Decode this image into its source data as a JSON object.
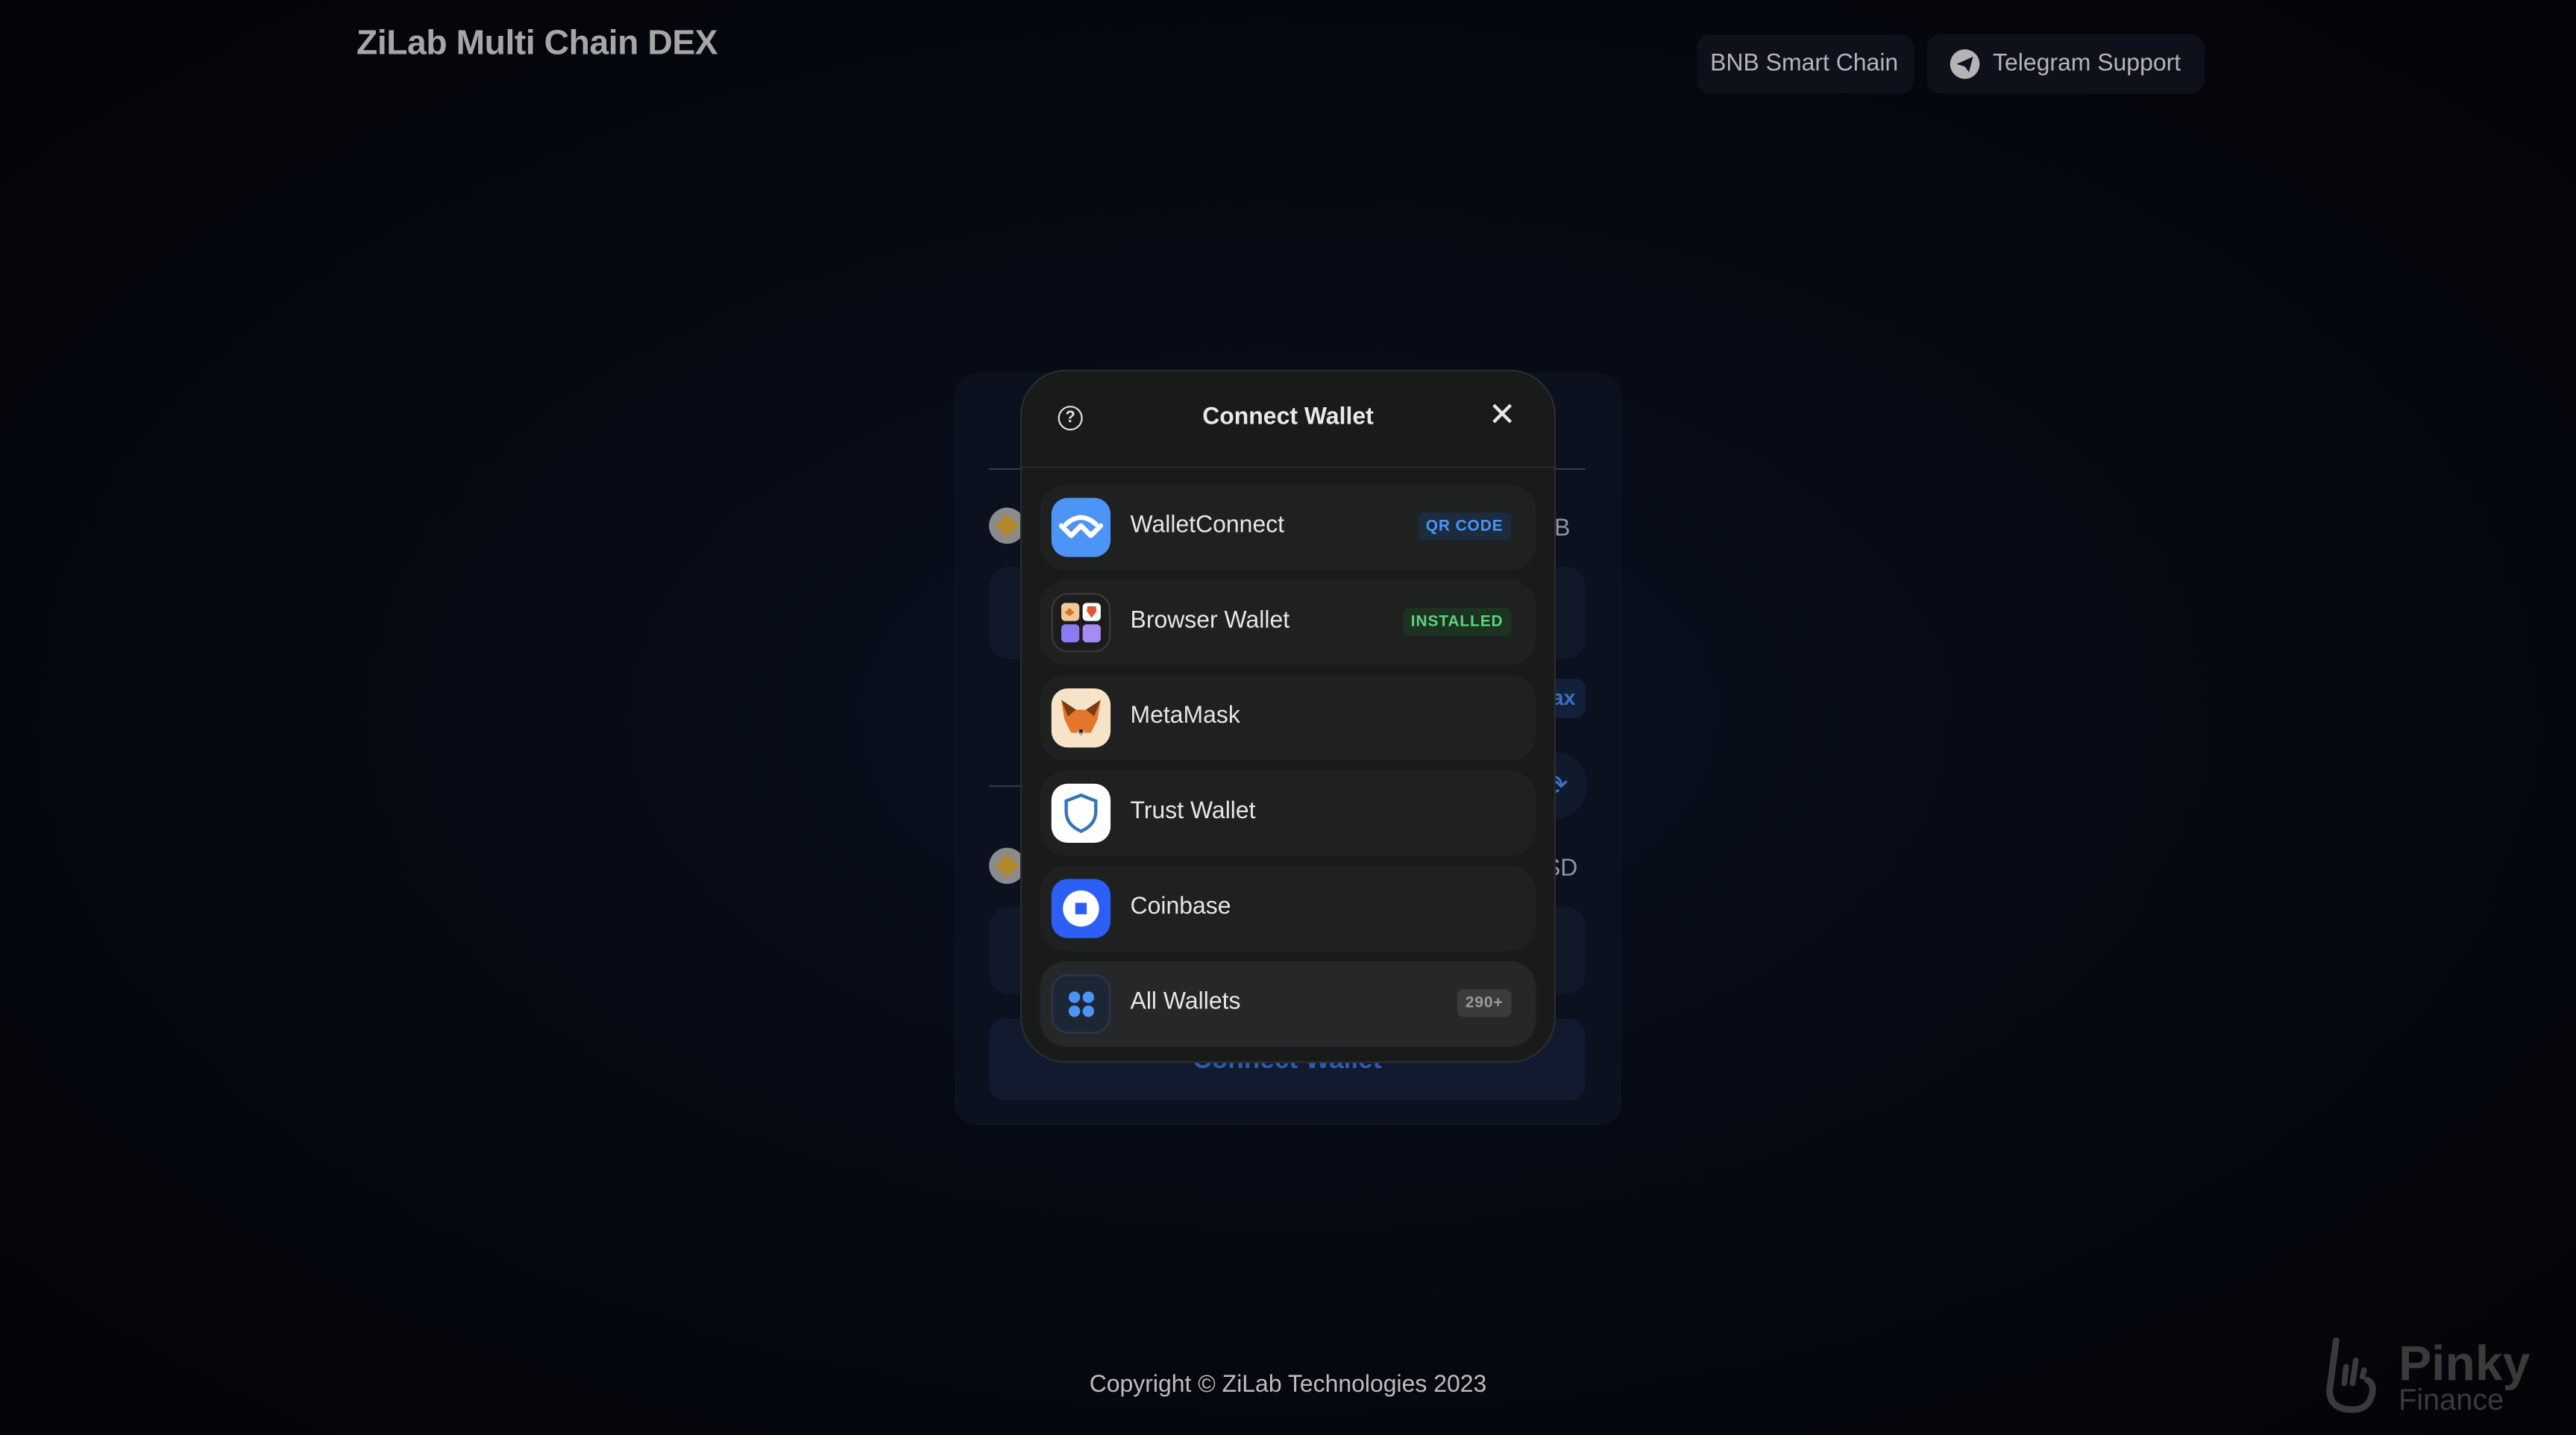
{
  "header": {
    "title": "ZiLab Multi Chain DEX",
    "network_button": "BNB Smart Chain",
    "support_button": "Telegram Support"
  },
  "swap_card": {
    "from_token": "BNB",
    "max_label": "Max",
    "to_token": "BUSD",
    "connect_button": "Connect Wallet"
  },
  "modal": {
    "title": "Connect Wallet",
    "wallets": [
      {
        "name": "WalletConnect",
        "badge": "QR CODE",
        "icon": "walletconnect-icon"
      },
      {
        "name": "Browser Wallet",
        "badge": "INSTALLED",
        "icon": "browser-wallet-icon"
      },
      {
        "name": "MetaMask",
        "icon": "metamask-fox-icon"
      },
      {
        "name": "Trust Wallet",
        "icon": "trust-shield-icon"
      },
      {
        "name": "Coinbase",
        "icon": "coinbase-icon"
      },
      {
        "name": "All Wallets",
        "badge": "290+",
        "icon": "grid-dots-icon"
      }
    ]
  },
  "footer": {
    "copyright": "Copyright © ZiLab Technologies 2023"
  },
  "watermark": {
    "brand": "Pinky Finance"
  },
  "colors": {
    "accent_blue": "#4c94f5",
    "installed_green": "#5fd27a",
    "modal_bg": "#191a1a"
  }
}
